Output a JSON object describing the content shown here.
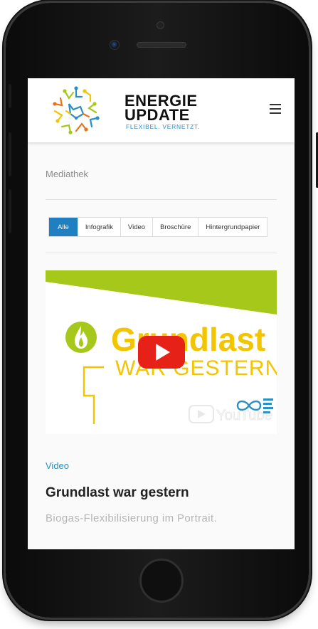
{
  "brand": {
    "line1": "ENERGIE",
    "line2": "UPDATE",
    "tagline": "FLEXIBEL. VERNETZT."
  },
  "page": {
    "section_title": "Mediathek"
  },
  "filters": [
    {
      "label": "Alle",
      "active": true
    },
    {
      "label": "Infografik",
      "active": false
    },
    {
      "label": "Video",
      "active": false
    },
    {
      "label": "Broschüre",
      "active": false
    },
    {
      "label": "Hintergrundpapier",
      "active": false
    }
  ],
  "video": {
    "headline_line1": "Grundlast",
    "headline_line2": "WAR GESTERN",
    "youtube_watermark": "YouTube"
  },
  "item": {
    "category": "Video",
    "title": "Grundlast war gestern",
    "subtitle": "Biogas-Flexibilisierung im Portrait."
  },
  "colors": {
    "accent_blue": "#1f7fc1",
    "lime": "#a5c81a",
    "yellow": "#f2c500",
    "youtube_red": "#e62117"
  },
  "icons": {
    "menu": "hamburger-menu-icon",
    "play": "youtube-play-icon",
    "flame": "flame-icon",
    "logo": "network-logo-icon"
  }
}
